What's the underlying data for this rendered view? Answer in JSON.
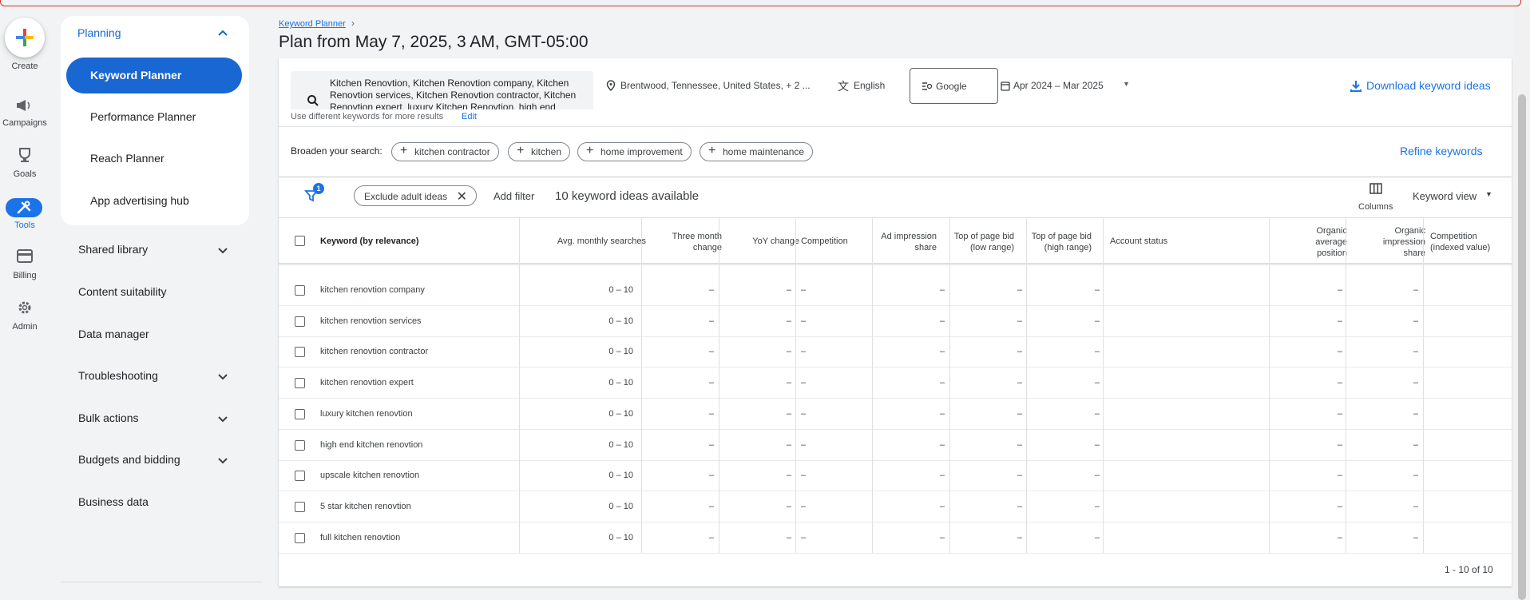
{
  "rail": {
    "create": "Create",
    "items": [
      {
        "label": "Campaigns",
        "icon": "campaigns-icon"
      },
      {
        "label": "Goals",
        "icon": "trophy-icon"
      },
      {
        "label": "Tools",
        "icon": "tools-icon"
      },
      {
        "label": "Billing",
        "icon": "billing-card-icon"
      },
      {
        "label": "Admin",
        "icon": "gear-icon"
      }
    ]
  },
  "sidebar": {
    "planning": "Planning",
    "sub_items": [
      "Keyword Planner",
      "Performance Planner",
      "Reach Planner",
      "App advertising hub"
    ],
    "nav": [
      "Shared library",
      "Content suitability",
      "Data manager",
      "Troubleshooting",
      "Bulk actions",
      "Budgets and bidding",
      "Business data"
    ]
  },
  "header": {
    "breadcrumb": "Keyword Planner",
    "title": "Plan from May 7, 2025, 3 AM, GMT-05:00"
  },
  "search": {
    "keywords": "Kitchen Renovtion, Kitchen Renovtion company, Kitchen Renovtion services, Kitchen Renovtion contractor, Kitchen Renovtion expert, luxury Kitchen Renovtion, high end",
    "hint": "Use different keywords for more results",
    "edit": "Edit",
    "location": "Brentwood, Tennessee, United States, + 2 ...",
    "language": "English",
    "network": "Google",
    "date_range": "Apr 2024 – Mar 2025",
    "download": "Download keyword ideas"
  },
  "broaden": {
    "label": "Broaden your search:",
    "chips": [
      "kitchen contractor",
      "kitchen",
      "home improvement",
      "home maintenance"
    ],
    "refine": "Refine keywords"
  },
  "toolbar": {
    "filter_count": "1",
    "exclude_chip": "Exclude adult ideas",
    "add_filter": "Add filter",
    "count": "10 keyword ideas available",
    "columns": "Columns",
    "view": "Keyword view"
  },
  "table": {
    "headers": {
      "keyword": "Keyword (by relevance)",
      "avg": "Avg. monthly searches",
      "three_month": [
        "Three month",
        "change"
      ],
      "yoy": "YoY change",
      "competition": "Competition",
      "ad_impr": [
        "Ad impression",
        "share"
      ],
      "top_low": [
        "Top of page bid",
        "(low range)"
      ],
      "top_high": [
        "Top of page bid",
        "(high range)"
      ],
      "account": "Account status",
      "org_pos": [
        "Organic",
        "average",
        "position"
      ],
      "org_impr": [
        "Organic",
        "impression",
        "share"
      ],
      "comp_idx": [
        "Competition",
        "(indexed value)"
      ]
    },
    "rows": [
      {
        "keyword": "kitchen renovtion company",
        "avg": "0 – 10",
        "three": "–",
        "yoy": "–",
        "comp": "–",
        "adimp": "–",
        "low": "–",
        "high": "–",
        "acct": "",
        "orgpos": "–",
        "orgimp": "–",
        "compidx": ""
      },
      {
        "keyword": "kitchen renovtion services",
        "avg": "0 – 10",
        "three": "–",
        "yoy": "–",
        "comp": "–",
        "adimp": "–",
        "low": "–",
        "high": "–",
        "acct": "",
        "orgpos": "–",
        "orgimp": "–",
        "compidx": ""
      },
      {
        "keyword": "kitchen renovtion contractor",
        "avg": "0 – 10",
        "three": "–",
        "yoy": "–",
        "comp": "–",
        "adimp": "–",
        "low": "–",
        "high": "–",
        "acct": "",
        "orgpos": "–",
        "orgimp": "–",
        "compidx": ""
      },
      {
        "keyword": "kitchen renovtion expert",
        "avg": "0 – 10",
        "three": "–",
        "yoy": "–",
        "comp": "–",
        "adimp": "–",
        "low": "–",
        "high": "–",
        "acct": "",
        "orgpos": "–",
        "orgimp": "–",
        "compidx": ""
      },
      {
        "keyword": "luxury kitchen renovtion",
        "avg": "0 – 10",
        "three": "–",
        "yoy": "–",
        "comp": "–",
        "adimp": "–",
        "low": "–",
        "high": "–",
        "acct": "",
        "orgpos": "–",
        "orgimp": "–",
        "compidx": ""
      },
      {
        "keyword": "high end kitchen renovtion",
        "avg": "0 – 10",
        "three": "–",
        "yoy": "–",
        "comp": "–",
        "adimp": "–",
        "low": "–",
        "high": "–",
        "acct": "",
        "orgpos": "–",
        "orgimp": "–",
        "compidx": ""
      },
      {
        "keyword": "upscale kitchen renovtion",
        "avg": "0 – 10",
        "three": "–",
        "yoy": "–",
        "comp": "–",
        "adimp": "–",
        "low": "–",
        "high": "–",
        "acct": "",
        "orgpos": "–",
        "orgimp": "–",
        "compidx": ""
      },
      {
        "keyword": "5 star kitchen renovtion",
        "avg": "0 – 10",
        "three": "–",
        "yoy": "–",
        "comp": "–",
        "adimp": "–",
        "low": "–",
        "high": "–",
        "acct": "",
        "orgpos": "–",
        "orgimp": "–",
        "compidx": ""
      },
      {
        "keyword": "full kitchen renovtion",
        "avg": "0 – 10",
        "three": "–",
        "yoy": "–",
        "comp": "–",
        "adimp": "–",
        "low": "–",
        "high": "–",
        "acct": "",
        "orgpos": "–",
        "orgimp": "–",
        "compidx": ""
      }
    ],
    "pager": "1 - 10 of 10"
  },
  "colors": {
    "accent": "#1a73e8",
    "active_nav": "#1967d2",
    "alert_border": "#d93025"
  }
}
